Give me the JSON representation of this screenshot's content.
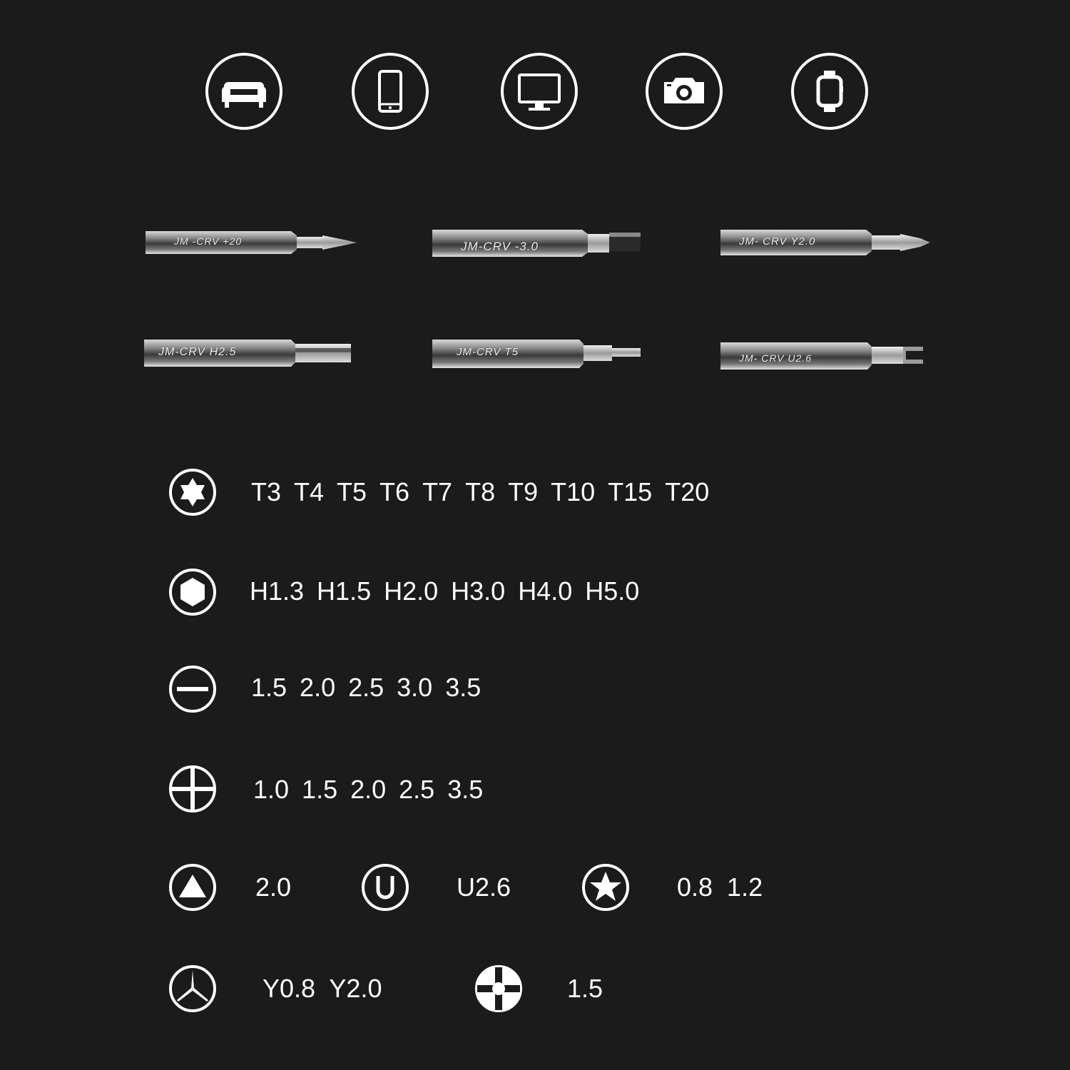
{
  "device_icons": [
    {
      "name": "sofa-icon"
    },
    {
      "name": "smartphone-icon"
    },
    {
      "name": "monitor-icon"
    },
    {
      "name": "camera-icon"
    },
    {
      "name": "smartwatch-icon"
    }
  ],
  "bits": [
    {
      "label": "JM -CRV  +20",
      "tip": "phillips"
    },
    {
      "label": "JM-CRV -3.0",
      "tip": "slotted"
    },
    {
      "label": "JM- CRV  Y2.0",
      "tip": "tri-wing"
    },
    {
      "label": "JM-CRV  H2.5",
      "tip": "hex"
    },
    {
      "label": "JM-CRV  T5",
      "tip": "torx"
    },
    {
      "label": "JM- CRV  U2.6",
      "tip": "u-fork"
    }
  ],
  "tip_rows": [
    {
      "icon": "torx-star-icon",
      "sizes": [
        "T3",
        "T4",
        "T5",
        "T6",
        "T7",
        "T8",
        "T9",
        "T10",
        "T15",
        "T20"
      ]
    },
    {
      "icon": "hexagon-icon",
      "sizes": [
        "H1.3",
        "H1.5",
        "H2.0",
        "H3.0",
        "H4.0",
        "H5.0"
      ]
    },
    {
      "icon": "slotted-icon",
      "sizes": [
        "1.5",
        "2.0",
        "2.5",
        "3.0",
        "3.5"
      ]
    },
    {
      "icon": "phillips-cross-icon",
      "sizes": [
        "1.0",
        "1.5",
        "2.0",
        "2.5",
        "3.5"
      ]
    }
  ],
  "row5": [
    {
      "icon": "triangle-icon",
      "text": "2.0"
    },
    {
      "icon": "u-shape-icon",
      "text": "U2.6"
    },
    {
      "icon": "pentalobe-star-icon",
      "text": "0.8  1.2"
    }
  ],
  "row6": [
    {
      "icon": "tri-wing-icon",
      "text": "Y0.8  Y2.0"
    },
    {
      "icon": "cross-pin-icon",
      "text": "1.5"
    }
  ]
}
